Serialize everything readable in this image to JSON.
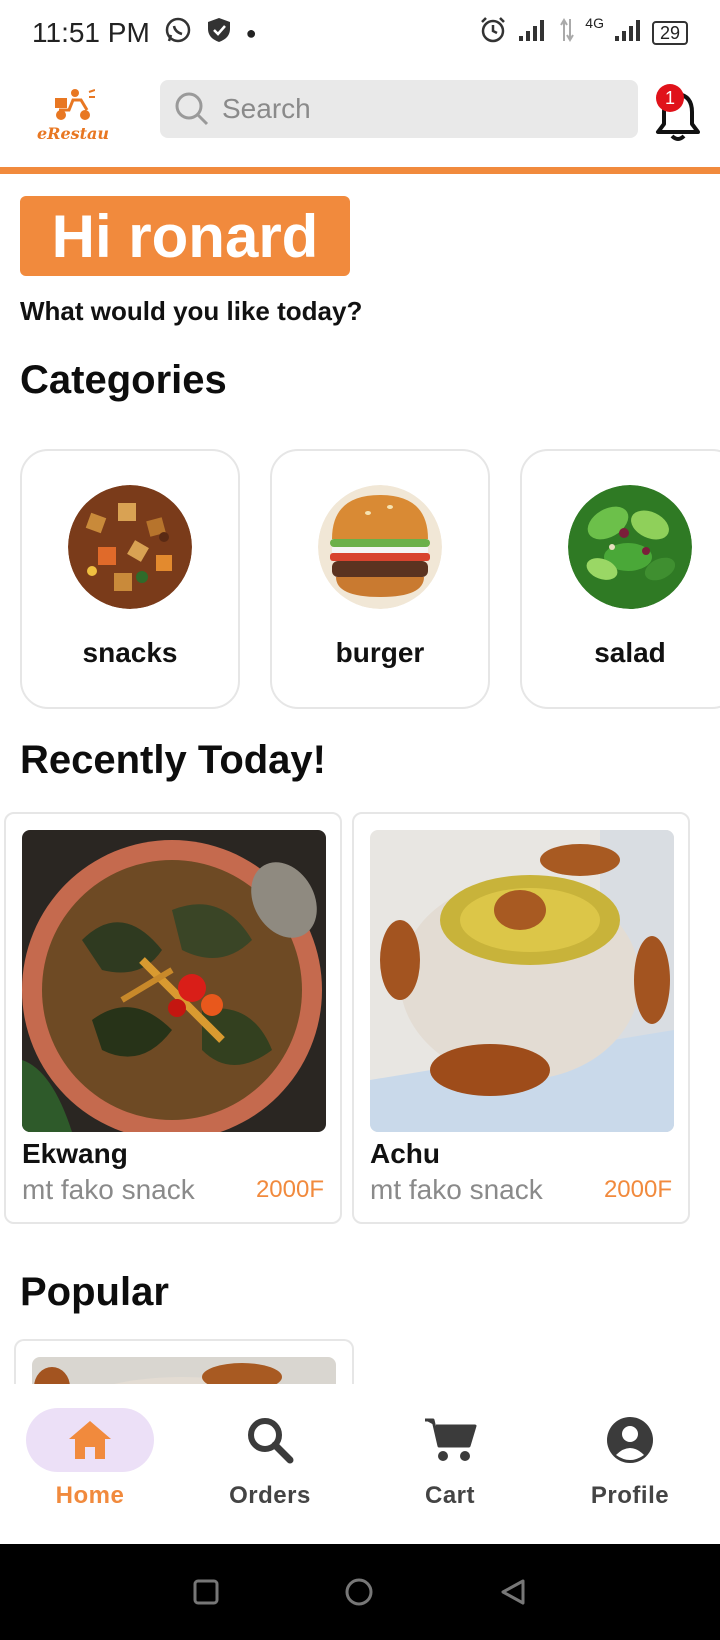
{
  "status_bar": {
    "time": "11:51 PM",
    "network": "4G",
    "battery": "29"
  },
  "header": {
    "logo_text": "eRestau",
    "search_placeholder": "Search",
    "notification_count": "1"
  },
  "greeting": {
    "hello": "Hi ronard",
    "subtitle": "What would you like today?"
  },
  "categories": {
    "title": "Categories",
    "items": [
      {
        "label": "snacks"
      },
      {
        "label": "burger"
      },
      {
        "label": "salad"
      }
    ]
  },
  "recent": {
    "title": "Recently Today!",
    "items": [
      {
        "name": "Ekwang",
        "restaurant": "mt fako snack",
        "price": "2000F"
      },
      {
        "name": "Achu",
        "restaurant": "mt fako snack",
        "price": "2000F"
      }
    ]
  },
  "popular": {
    "title": "Popular"
  },
  "bottom_nav": {
    "items": [
      {
        "label": "Home",
        "icon": "home-icon",
        "active": true
      },
      {
        "label": "Orders",
        "icon": "search-icon",
        "active": false
      },
      {
        "label": "Cart",
        "icon": "cart-icon",
        "active": false
      },
      {
        "label": "Profile",
        "icon": "profile-icon",
        "active": false
      }
    ]
  },
  "colors": {
    "accent": "#f18a3d",
    "badge": "#e0121a",
    "active_pill": "#ece0f7"
  }
}
